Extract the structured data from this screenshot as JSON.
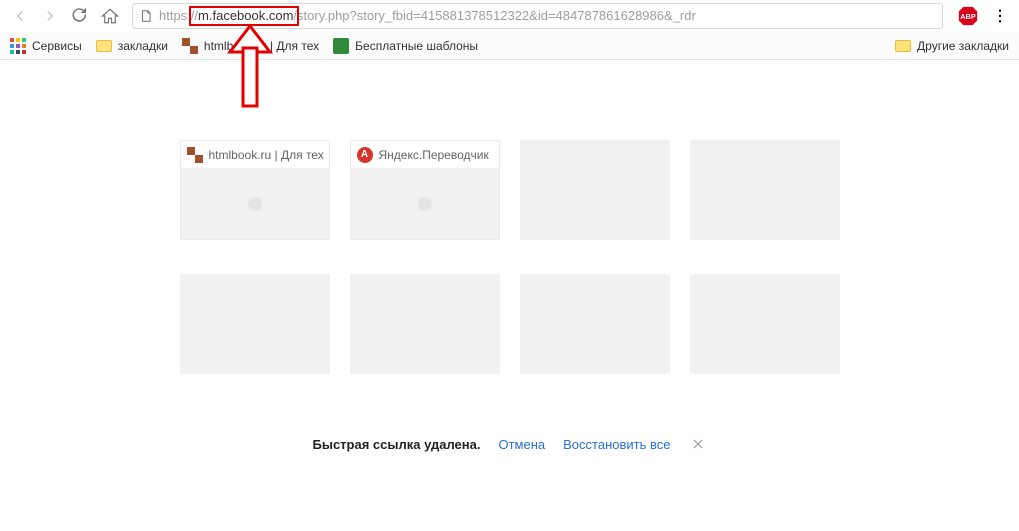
{
  "toolbar": {
    "url_scheme": "https://",
    "url_host": "m.facebook.com",
    "url_rest": "/story.php?story_fbid=415881378512322&id=484787861628986&_rdr"
  },
  "bookmarks": {
    "services": "Сервисы",
    "b_zakladki": "закладки",
    "b_htmlbook": "htmlbook.ru | Для тех",
    "b_templates": "Бесплатные шаблоны",
    "other": "Другие закладки"
  },
  "tiles": {
    "t0": "htmlbook.ru | Для тех",
    "t1": "Яндекс.Переводчик"
  },
  "toast": {
    "msg": "Быстрая ссылка удалена.",
    "undo": "Отмена",
    "restore_all": "Восстановить все"
  }
}
